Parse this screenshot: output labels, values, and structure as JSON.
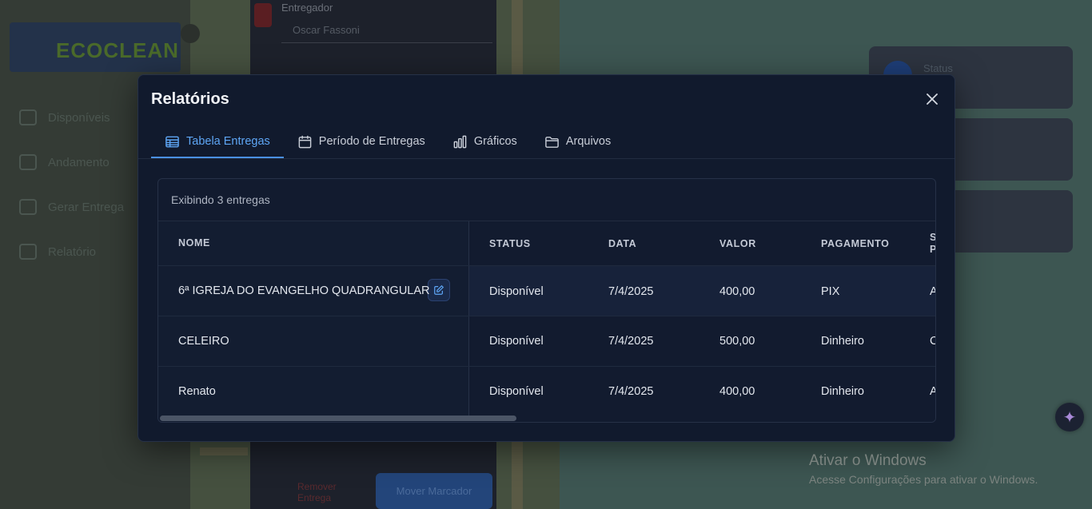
{
  "background": {
    "logo_text": "ECOCLEAN",
    "nav": [
      "Disponíveis",
      "Andamento",
      "Gerar Entrega",
      "Relatório"
    ],
    "panel_label": "Entregador",
    "panel_select": "Oscar Fassoni",
    "panel_button": "Mover Marcador",
    "panel_red_button": "Remover Entrega",
    "cards": [
      "Status",
      "",
      ""
    ]
  },
  "modal": {
    "title": "Relatórios",
    "tabs": [
      {
        "label": "Tabela Entregas",
        "icon": "table-icon",
        "active": true
      },
      {
        "label": "Período de Entregas",
        "icon": "calendar-icon",
        "active": false
      },
      {
        "label": "Gráficos",
        "icon": "bar-chart-icon",
        "active": false
      },
      {
        "label": "Arquivos",
        "icon": "folder-icon",
        "active": false
      }
    ],
    "count_text": "Exibindo 3 entregas",
    "columns": [
      "NOME",
      "STATUS",
      "DATA",
      "VALOR",
      "PAGAMENTO",
      "S P"
    ],
    "rows": [
      {
        "nome": "6ª IGREJA DO EVANGELHO QUADRANGULAR",
        "status": "Disponível",
        "data": "7/4/2025",
        "valor": "400,00",
        "pagamento": "PIX",
        "extra": "A"
      },
      {
        "nome": "CELEIRO",
        "status": "Disponível",
        "data": "7/4/2025",
        "valor": "500,00",
        "pagamento": "Dinheiro",
        "extra": "C"
      },
      {
        "nome": "Renato",
        "status": "Disponível",
        "data": "7/4/2025",
        "valor": "400,00",
        "pagamento": "Dinheiro",
        "extra": "A"
      }
    ]
  },
  "windows_activation": {
    "title": "Ativar o Windows",
    "subtitle": "Acesse Configurações para ativar o Windows."
  },
  "colors": {
    "accent": "#4a90e2",
    "modal_bg": "#111a2d"
  }
}
